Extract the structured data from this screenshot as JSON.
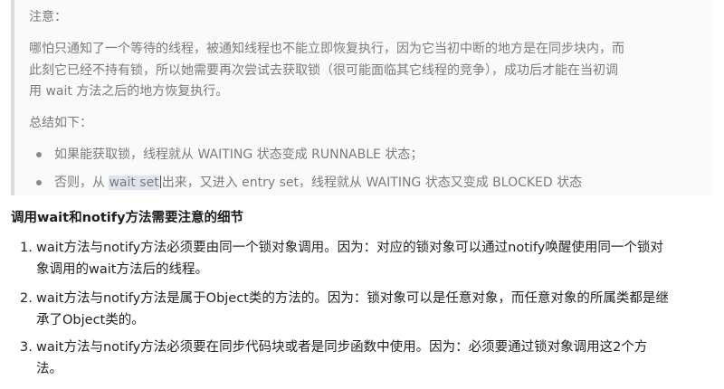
{
  "quote": {
    "heading": "注意：",
    "paragraph_lines": [
      "哪怕只通知了一个等待的线程，被通知线程也不能立即恢复执行，因为它当初中断的地方是在同步块内，而",
      "此刻它已经不持有锁，所以她需要再次尝试去获取锁（很可能面临其它线程的竞争），成功后才能在当初调",
      "用 wait 方法之后的地方恢复执行。"
    ],
    "summary": "总结如下：",
    "bullets": [
      {
        "text": "如果能获取锁，线程就从 WAITING 状态变成 RUNNABLE 状态；"
      },
      {
        "before": "否则，从 ",
        "highlight": "wait set",
        "after": "出来，又进入 entry set，线程就从 WAITING 状态又变成 BLOCKED 状态"
      }
    ]
  },
  "section": {
    "title": "调用wait和notify方法需要注意的细节"
  },
  "items": [
    {
      "num": "1.",
      "lines": [
        "wait方法与notify方法必须要由同一个锁对象调用。因为：对应的锁对象可以通过notify唤醒使用同一个锁对",
        "象调用的wait方法后的线程。"
      ]
    },
    {
      "num": "2.",
      "lines": [
        "wait方法与notify方法是属于Object类的方法的。因为：锁对象可以是任意对象，而任意对象的所属类都是继",
        "承了Object类的。"
      ]
    },
    {
      "num": "3.",
      "lines": [
        "wait方法与notify方法必须要在同步代码块或者是同步函数中使用。因为：必须要通过锁对象调用这2个方",
        "法。"
      ]
    }
  ]
}
